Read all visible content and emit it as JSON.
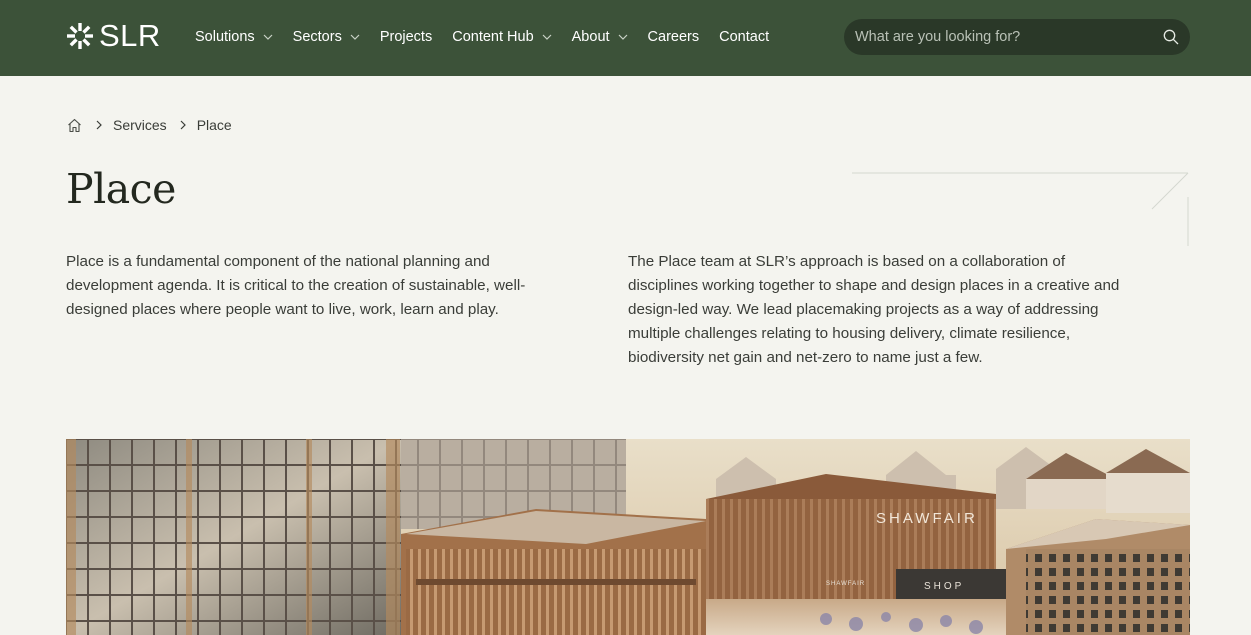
{
  "header": {
    "logo_text": "SLR",
    "nav": [
      {
        "label": "Solutions",
        "has_dropdown": true
      },
      {
        "label": "Sectors",
        "has_dropdown": true
      },
      {
        "label": "Projects",
        "has_dropdown": false
      },
      {
        "label": "Content Hub",
        "has_dropdown": true
      },
      {
        "label": "About",
        "has_dropdown": true
      },
      {
        "label": "Careers",
        "has_dropdown": false
      },
      {
        "label": "Contact",
        "has_dropdown": false
      }
    ],
    "search": {
      "placeholder": "What are you looking for?",
      "value": "",
      "icon": "search-icon"
    }
  },
  "breadcrumb": {
    "home_icon": "home-icon",
    "items": [
      "Services",
      "Place"
    ]
  },
  "page": {
    "title": "Place",
    "intro_left": "Place is a fundamental component of the national planning and development agenda. It is critical to the creation of sustainable, well-designed places where people want to live, work, learn and play.",
    "intro_right": "The Place team at SLR’s approach is based on a collaboration of disciplines working together to shape and design places in a creative and design-led way. We lead placemaking projects as a way of addressing multiple challenges relating to housing delivery, climate resilience, biodiversity net gain and net-zero to name just a few."
  },
  "hero": {
    "signs": [
      "SHAWFAIR",
      "SHAWFAIR",
      "SHOP"
    ]
  },
  "colors": {
    "header_bg": "#3c5239",
    "search_bg": "#2a3828",
    "page_bg": "#f4f4ef",
    "title": "#23281f",
    "text": "#3a3d38"
  }
}
